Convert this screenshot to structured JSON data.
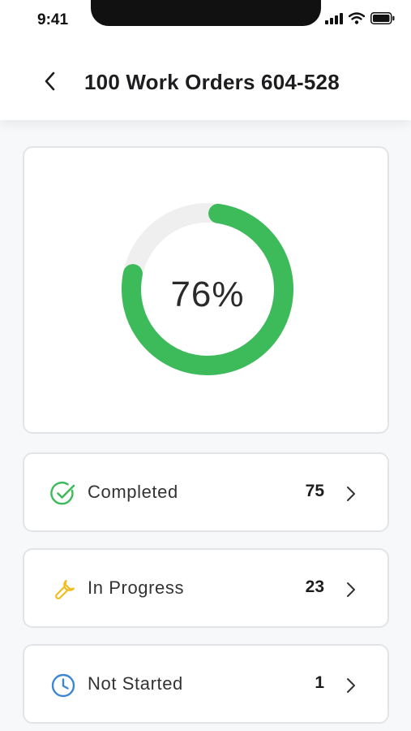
{
  "status_bar": {
    "time": "9:41"
  },
  "header": {
    "title": "100 Work Orders 604-528"
  },
  "progress": {
    "percent_label": "76%",
    "fraction": 0.76,
    "fill_color": "#3dba5a",
    "track_color": "#efefef"
  },
  "statuses": [
    {
      "label": "Completed",
      "count": "75",
      "icon": "check-circle-icon",
      "color": "#3dba5a"
    },
    {
      "label": "In Progress",
      "count": "23",
      "icon": "wrench-icon",
      "color": "#f2bd1c"
    },
    {
      "label": "Not Started",
      "count": "1",
      "icon": "clock-icon",
      "color": "#3b86d6"
    }
  ]
}
